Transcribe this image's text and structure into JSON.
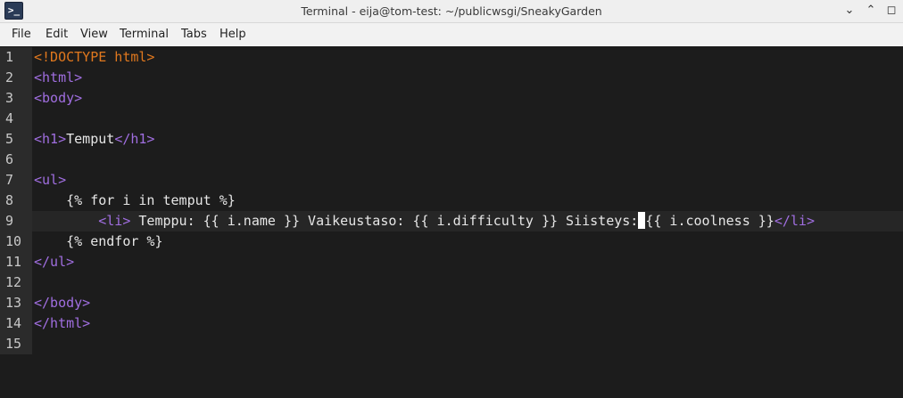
{
  "window": {
    "title": "Terminal - eija@tom-test: ~/publicwsgi/SneakyGarden",
    "app_icon_text": ">_",
    "minimize": "⌄",
    "maximize": "⌃",
    "close": "◻"
  },
  "menu": [
    "File",
    "Edit",
    "View",
    "Terminal",
    "Tabs",
    "Help"
  ],
  "lines": [
    {
      "n": "1",
      "segments": [
        {
          "k": "doctype",
          "t": "<!DOCTYPE html>"
        }
      ]
    },
    {
      "n": "2",
      "segments": [
        {
          "k": "tag",
          "t": "<html>"
        }
      ]
    },
    {
      "n": "3",
      "segments": [
        {
          "k": "tag",
          "t": "<body>"
        }
      ]
    },
    {
      "n": "4",
      "segments": []
    },
    {
      "n": "5",
      "segments": [
        {
          "k": "tag",
          "t": "<h1>"
        },
        {
          "k": "txt",
          "t": "Temput"
        },
        {
          "k": "tag",
          "t": "</h1>"
        }
      ]
    },
    {
      "n": "6",
      "segments": []
    },
    {
      "n": "7",
      "segments": [
        {
          "k": "tag",
          "t": "<ul>"
        }
      ]
    },
    {
      "n": "8",
      "segments": [
        {
          "k": "txt",
          "t": "    {% for i in temput %}"
        }
      ]
    },
    {
      "n": "9",
      "current": true,
      "segments": [
        {
          "k": "txt",
          "t": "        "
        },
        {
          "k": "tag",
          "t": "<li>"
        },
        {
          "k": "txt",
          "t": " Temppu: {{ i.name }} Vaikeustaso: {{ i.difficulty }} Siisteys:"
        },
        {
          "k": "cursor",
          "t": ""
        },
        {
          "k": "txt",
          "t": "{{ i.coolness }}"
        },
        {
          "k": "tag",
          "t": "</li>"
        }
      ]
    },
    {
      "n": "10",
      "segments": [
        {
          "k": "txt",
          "t": "    {% endfor %}"
        }
      ]
    },
    {
      "n": "11",
      "segments": [
        {
          "k": "tag",
          "t": "</ul>"
        }
      ]
    },
    {
      "n": "12",
      "segments": []
    },
    {
      "n": "13",
      "segments": [
        {
          "k": "tag",
          "t": "</body>"
        }
      ]
    },
    {
      "n": "14",
      "segments": [
        {
          "k": "tag",
          "t": "</html>"
        }
      ]
    },
    {
      "n": "15",
      "segments": []
    }
  ]
}
